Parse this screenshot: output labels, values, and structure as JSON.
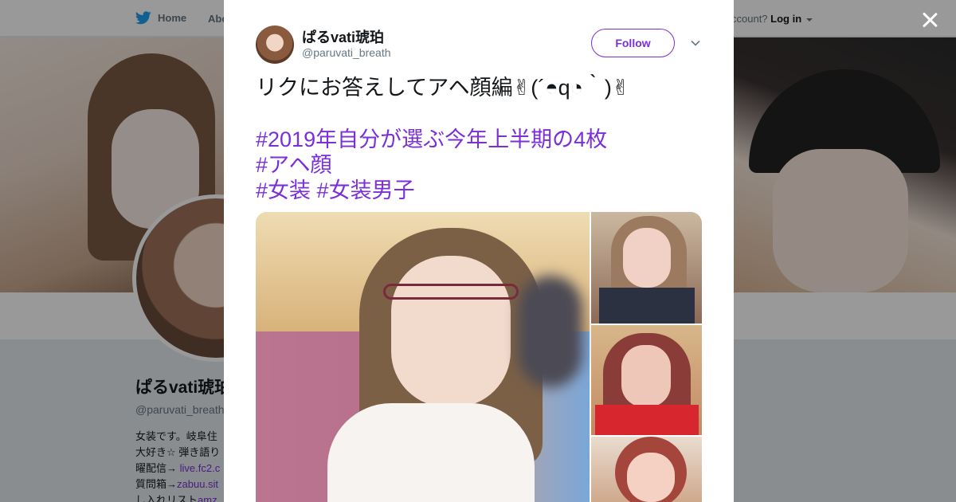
{
  "nav": {
    "home_label": "Home",
    "about_label": "Abo",
    "account_prefix": "ccount?",
    "login_label": "Log in"
  },
  "profile": {
    "name": "ぱるvati琥珀",
    "handle": "@paruvati_breath",
    "bio_lines": [
      "女装です。岐阜住",
      "大好き☆ 弾き語り",
      "曜配信→ ",
      "質問箱→",
      "し入れリスト"
    ],
    "bio_links": [
      "live.fc2.c",
      "zabuu.sit",
      "amz"
    ]
  },
  "tweet": {
    "name": "ぱるvati琥珀",
    "handle": "@paruvati_breath",
    "follow_label": "Follow",
    "text": "リクにお答えしてアヘ顔編✌(´◓q◔｀)✌",
    "hashtags_line1": "#2019年自分が選ぶ今年上半期の4枚",
    "hashtags_line2": "#アヘ顔",
    "hashtags_line3a": "#女装",
    "hashtags_line3b": "#女装男子"
  },
  "colors": {
    "accent": "#7b2fd8",
    "twitter_blue": "#1da1f2",
    "text_primary": "#14171a",
    "text_secondary": "#657786"
  },
  "icons": {
    "close": "close-icon",
    "bird": "twitter-bird-icon",
    "caret": "chevron-down-icon"
  }
}
